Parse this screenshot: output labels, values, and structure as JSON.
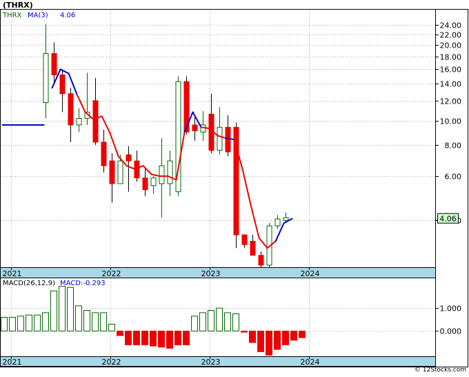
{
  "header": {
    "title": "(THRX)"
  },
  "footer": {
    "credit": "© 12Stocks.com"
  },
  "colors": {
    "up": "#006400",
    "down": "#ee0000",
    "ma": "#0000cc",
    "ma_red": "#ee0000",
    "axis_band": "#a8d8e8",
    "last_box": "#ccffcc"
  },
  "chart_data": [
    {
      "type": "candlestick",
      "legend": {
        "ticker": "THRX",
        "ma_label": "MA(3)",
        "ma_value": "4.06"
      },
      "y_scale": "log",
      "ylim": [
        2.6,
        27.5
      ],
      "y_ticks": [
        4.0,
        6.0,
        8.0,
        10.0,
        12.0,
        14.0,
        16.0,
        18.0,
        20.0,
        22.0,
        24.0
      ],
      "y_tick_labels": [
        "4.00",
        "6.00",
        "8.00",
        "10.00",
        "12.00",
        "14.00",
        "16.00",
        "18.00",
        "20.00",
        "22.00",
        "24.00"
      ],
      "last_value_label": "4.06",
      "last_value": 4.06,
      "x_labels": [
        {
          "label": "2021",
          "index": -4.2
        },
        {
          "label": "2022",
          "index": 7.8
        },
        {
          "label": "2023",
          "index": 19.8
        },
        {
          "label": "2024",
          "index": 31.8
        }
      ],
      "candles": [
        {
          "o": 11.8,
          "h": 24.2,
          "l": 10.2,
          "c": 18.5
        },
        {
          "o": 18.5,
          "h": 20.5,
          "l": 14.0,
          "c": 15.2
        },
        {
          "o": 15.2,
          "h": 16.0,
          "l": 10.8,
          "c": 12.8
        },
        {
          "o": 12.8,
          "h": 13.5,
          "l": 8.2,
          "c": 9.6
        },
        {
          "o": 9.6,
          "h": 11.2,
          "l": 9.0,
          "c": 10.2
        },
        {
          "o": 10.2,
          "h": 15.5,
          "l": 9.6,
          "c": 10.8
        },
        {
          "o": 12.0,
          "h": 14.8,
          "l": 8.0,
          "c": 8.2
        },
        {
          "o": 8.2,
          "h": 9.2,
          "l": 6.2,
          "c": 6.6
        },
        {
          "o": 6.9,
          "h": 7.4,
          "l": 4.7,
          "c": 5.6
        },
        {
          "o": 5.6,
          "h": 7.3,
          "l": 5.6,
          "c": 6.9
        },
        {
          "o": 7.3,
          "h": 7.9,
          "l": 5.2,
          "c": 6.9
        },
        {
          "o": 6.9,
          "h": 7.6,
          "l": 5.7,
          "c": 5.9
        },
        {
          "o": 5.9,
          "h": 6.5,
          "l": 5.0,
          "c": 5.3
        },
        {
          "o": 5.5,
          "h": 6.0,
          "l": 5.1,
          "c": 5.9
        },
        {
          "o": 5.6,
          "h": 8.5,
          "l": 4.1,
          "c": 6.6
        },
        {
          "o": 5.6,
          "h": 7.6,
          "l": 5.0,
          "c": 6.9
        },
        {
          "o": 5.2,
          "h": 15.0,
          "l": 5.0,
          "c": 14.3
        },
        {
          "o": 14.3,
          "h": 15.0,
          "l": 8.8,
          "c": 9.0
        },
        {
          "o": 9.6,
          "h": 10.3,
          "l": 8.3,
          "c": 9.1
        },
        {
          "o": 9.0,
          "h": 10.9,
          "l": 8.3,
          "c": 9.6
        },
        {
          "o": 10.6,
          "h": 12.8,
          "l": 7.4,
          "c": 7.6
        },
        {
          "o": 7.6,
          "h": 11.3,
          "l": 7.3,
          "c": 9.4
        },
        {
          "o": 9.4,
          "h": 10.5,
          "l": 7.2,
          "c": 7.5
        },
        {
          "o": 9.4,
          "h": 9.8,
          "l": 3.1,
          "c": 3.5
        },
        {
          "o": 3.5,
          "h": 3.5,
          "l": 3.1,
          "c": 3.2
        },
        {
          "o": 3.3,
          "h": 3.5,
          "l": 2.9,
          "c": 2.9
        },
        {
          "o": 2.9,
          "h": 3.0,
          "l": 2.6,
          "c": 2.65
        },
        {
          "o": 2.65,
          "h": 3.9,
          "l": 2.6,
          "c": 3.8
        },
        {
          "o": 3.8,
          "h": 4.2,
          "l": 3.7,
          "c": 4.05
        },
        {
          "o": 4.0,
          "h": 4.3,
          "l": 3.9,
          "c": 4.1
        }
      ],
      "ma_line": [
        {
          "start": -5.2,
          "values": [
            9.6,
            9.6,
            9.6,
            9.6,
            9.6,
            9.6
          ]
        },
        {
          "start": 0.8,
          "values": [
            13.5,
            16.0,
            15.4,
            12.7,
            10.8,
            10.1,
            10.4,
            8.9,
            7.2,
            6.6,
            6.4,
            6.6,
            6.1,
            6.0,
            6.0,
            5.8,
            9.0,
            10.8,
            9.4,
            9.3,
            8.7,
            8.5,
            8.4,
            6.4,
            4.6,
            3.4,
            3.1,
            3.3,
            3.9,
            4.06
          ]
        }
      ],
      "ma_blue_ranges": [
        [
          -5.2,
          0.8
        ],
        [
          0.8,
          3.8
        ],
        [
          16.8,
          18.8
        ],
        [
          21.8,
          22.8
        ],
        [
          27.8,
          29.8
        ]
      ]
    },
    {
      "type": "bar",
      "legend": {
        "label": "MACD(26,12,9)",
        "value_label": "MACD:-0.293"
      },
      "ylim": [
        -1.1,
        2.3
      ],
      "y_ticks": [
        0.0,
        1.0
      ],
      "y_tick_labels": [
        "0.000",
        "1.000"
      ],
      "x_labels": [
        {
          "label": "2021",
          "index": -4.2
        },
        {
          "label": "2022",
          "index": 7.8
        },
        {
          "label": "2023",
          "index": 19.8
        },
        {
          "label": "2024",
          "index": 31.8
        }
      ],
      "bars": [
        {
          "i": -5,
          "v": 0.6
        },
        {
          "i": -4,
          "v": 0.6
        },
        {
          "i": -3,
          "v": 0.65
        },
        {
          "i": -2,
          "v": 0.7
        },
        {
          "i": -1,
          "v": 0.7
        },
        {
          "i": 0,
          "v": 0.8
        },
        {
          "i": 1,
          "v": 1.75
        },
        {
          "i": 2,
          "v": 1.95
        },
        {
          "i": 3,
          "v": 1.9
        },
        {
          "i": 4,
          "v": 1.1
        },
        {
          "i": 5,
          "v": 0.9
        },
        {
          "i": 6,
          "v": 0.8
        },
        {
          "i": 7,
          "v": 0.8
        },
        {
          "i": 8,
          "v": 0.3
        },
        {
          "i": 9,
          "v": -0.2
        },
        {
          "i": 10,
          "v": -0.6
        },
        {
          "i": 11,
          "v": -0.6
        },
        {
          "i": 12,
          "v": -0.6
        },
        {
          "i": 13,
          "v": -0.65
        },
        {
          "i": 14,
          "v": -0.7
        },
        {
          "i": 15,
          "v": -0.75
        },
        {
          "i": 16,
          "v": -0.6
        },
        {
          "i": 17,
          "v": -0.6
        },
        {
          "i": 18,
          "v": 0.65
        },
        {
          "i": 19,
          "v": 0.8
        },
        {
          "i": 20,
          "v": 0.9
        },
        {
          "i": 21,
          "v": 1.0
        },
        {
          "i": 22,
          "v": 0.8
        },
        {
          "i": 23,
          "v": 0.75
        },
        {
          "i": 24,
          "v": -0.05
        },
        {
          "i": 25,
          "v": -0.5
        },
        {
          "i": 26,
          "v": -0.9
        },
        {
          "i": 27,
          "v": -1.05
        },
        {
          "i": 28,
          "v": -0.8
        },
        {
          "i": 29,
          "v": -0.6
        },
        {
          "i": 30,
          "v": -0.4
        },
        {
          "i": 31,
          "v": -0.29
        }
      ]
    }
  ]
}
